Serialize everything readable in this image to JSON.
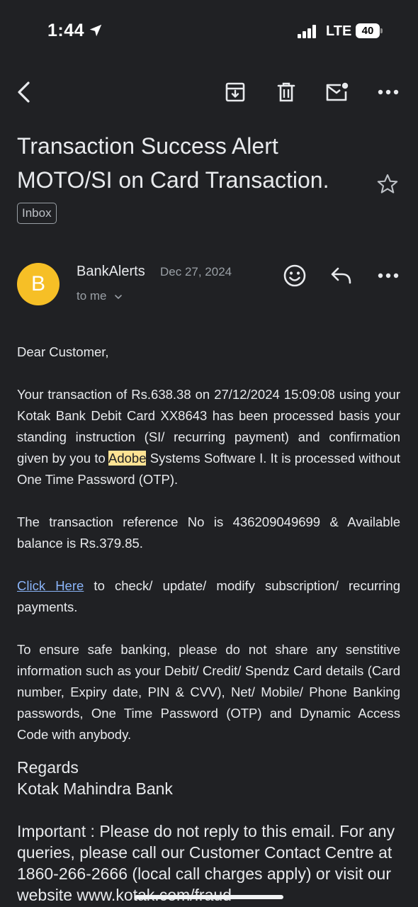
{
  "status": {
    "time": "1:44",
    "network": "LTE",
    "battery": "40"
  },
  "email": {
    "subject_line1": "Transaction Success Alert",
    "subject_line2": "MOTO/SI on Card Transaction.",
    "label": "Inbox",
    "sender_initial": "B",
    "sender_name": "BankAlerts",
    "date": "Dec 27, 2024",
    "recipient": "to me",
    "greeting": "Dear Customer,",
    "para1_before": "Your transaction of Rs.638.38 on 27/12/2024 15:09:08 using your Kotak Bank Debit Card XX8643 has been processed basis your standing instruction (SI/ recurring payment) and confirmation given by you to ",
    "para1_highlight": "Adobe",
    "para1_after": " Systems Software I. It is processed without One Time Password (OTP).",
    "para2": "The transaction reference No is 436209049699 & Available balance is Rs.379.85.",
    "link_text": "Click Here",
    "para3_after": " to check/ update/ modify subscription/ recurring payments.",
    "para4": "To ensure safe banking, please do not share any senstitive information such as your Debit/ Credit/ Spendz Card details (Card number, Expiry date, PIN & CVV), Net/ Mobile/ Phone Banking passwords, One Time Password (OTP) and Dynamic Access Code with anybody.",
    "regards": "Regards",
    "bank_name": "Kotak Mahindra Bank",
    "important": "Important : Please do not reply to this email. For any queries, please call our Customer Contact Centre at 1860-266-2666 (local call charges apply) or visit our website www.kotak.com/fraud"
  },
  "icons": {
    "back": "back-arrow-icon",
    "archive": "archive-icon",
    "delete": "trash-icon",
    "unread": "mark-unread-icon",
    "more": "more-icon",
    "star": "star-icon",
    "react": "emoji-icon",
    "reply": "reply-icon"
  },
  "colors": {
    "background": "#202124",
    "avatar": "#f6bf26",
    "link": "#8ab4f8",
    "highlight": "#fde293"
  }
}
